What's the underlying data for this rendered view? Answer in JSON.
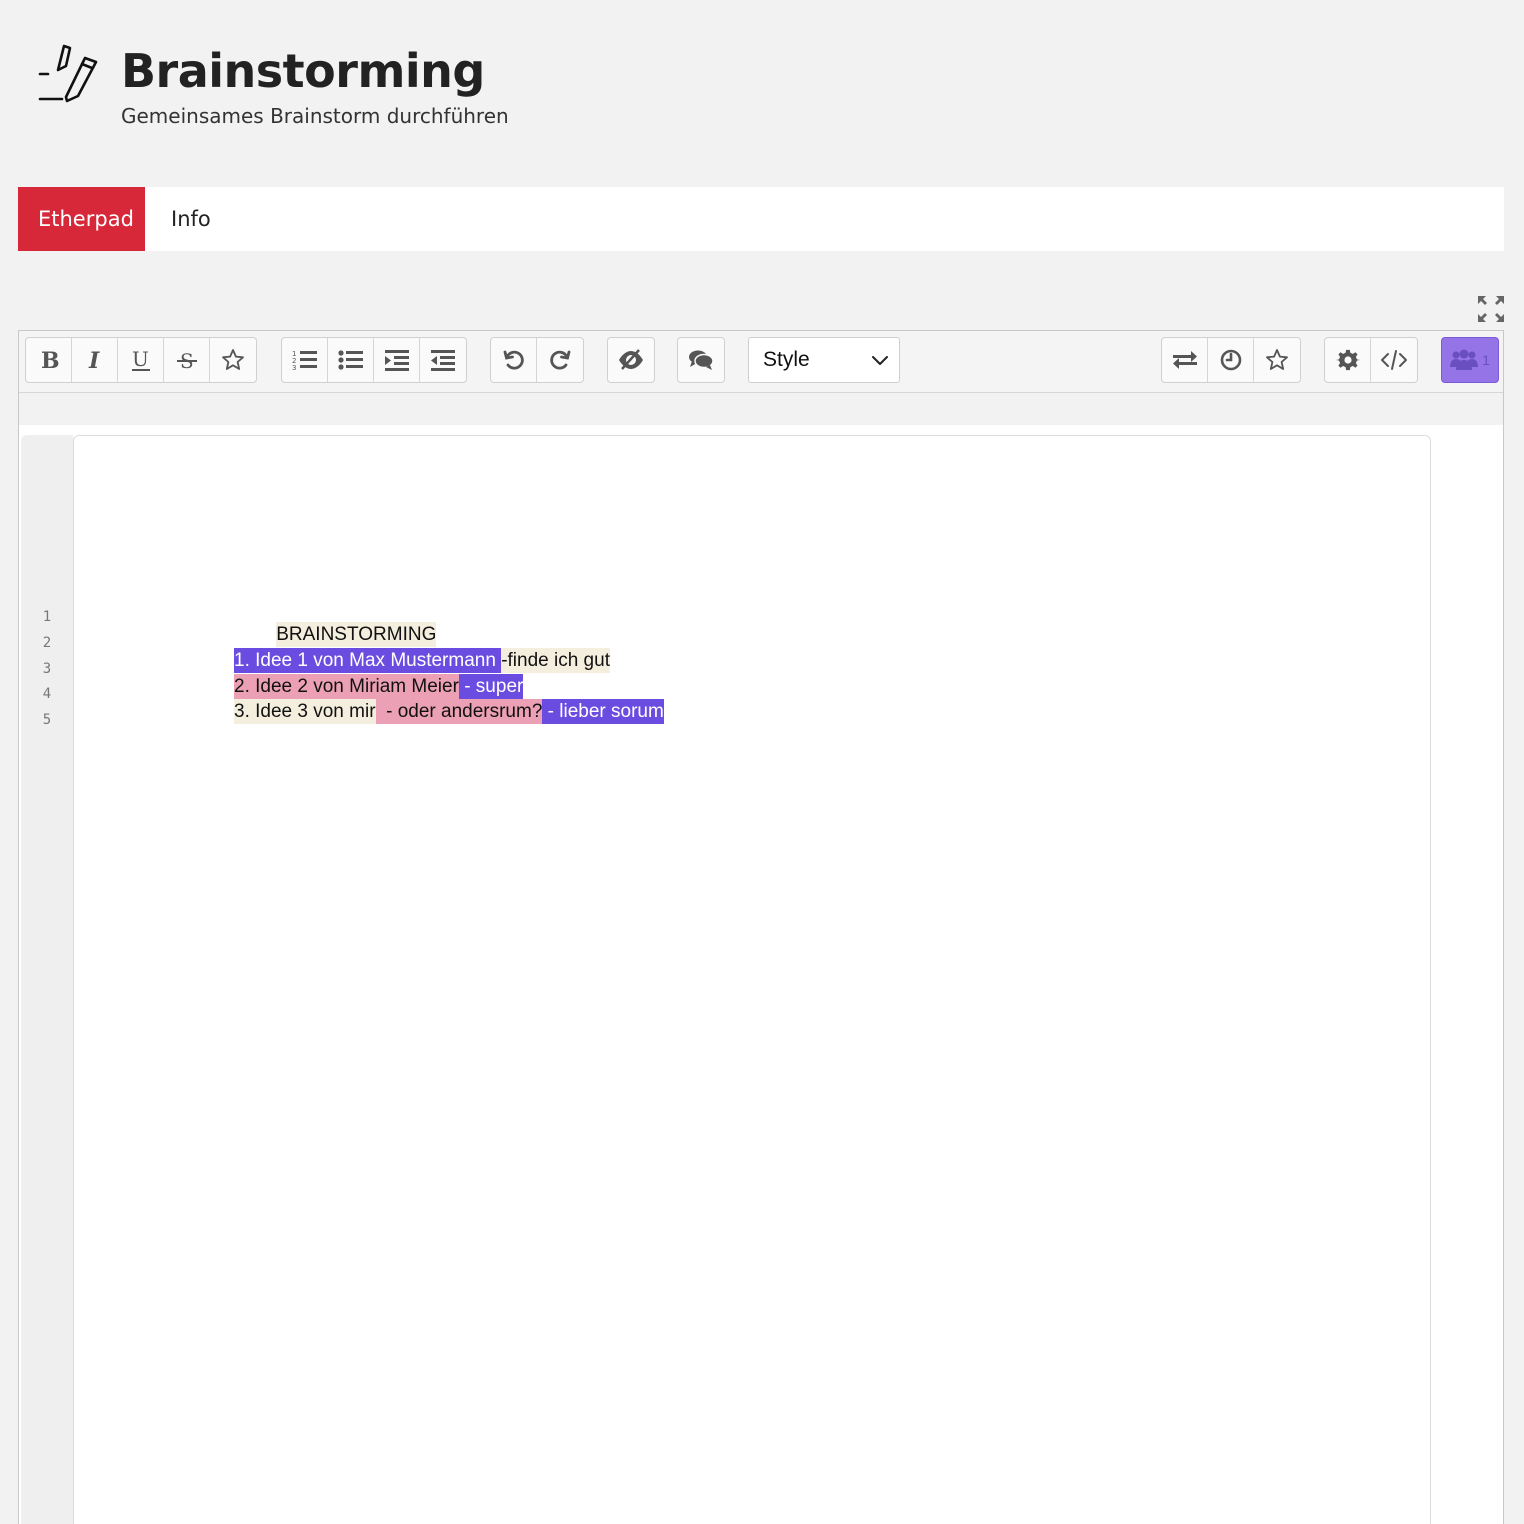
{
  "header": {
    "title": "Brainstorming",
    "subtitle": "Gemeinsames Brainstorm durchführen",
    "icon": "pencil-icon"
  },
  "tabs": [
    {
      "label": "Etherpad",
      "active": true
    },
    {
      "label": "Info",
      "active": false
    }
  ],
  "toolbar": {
    "style_label": "Style",
    "users_count": "1",
    "groups": [
      [
        "bold-icon",
        "italic-icon",
        "underline-icon",
        "strikethrough-icon",
        "star-icon"
      ],
      [
        "ordered-list-icon",
        "unordered-list-icon",
        "indent-icon",
        "outdent-icon"
      ],
      [
        "undo-icon",
        "redo-icon"
      ],
      [
        "eye-slash-icon"
      ],
      [
        "comments-icon"
      ],
      [
        "import-export-icon",
        "history-icon",
        "star-icon"
      ],
      [
        "settings-icon",
        "embed-icon"
      ],
      [
        "users-icon"
      ]
    ]
  },
  "colors": {
    "tab_active": "#d7283a",
    "author_cream": "#f4eede",
    "author_purple": "#6a4de0",
    "author_pink": "#eba0b5"
  },
  "editor": {
    "line_numbers": [
      "1",
      "2",
      "3",
      "4",
      "5"
    ],
    "lines": [
      {
        "segments": [
          {
            "text": "BRAINSTORMING",
            "author": "cream"
          }
        ]
      },
      {
        "segments": []
      },
      {
        "segments": [
          {
            "text": "1. Idee 1 von Max Mustermann ",
            "author": "purple"
          },
          {
            "text": "-finde ich gut",
            "author": "cream"
          }
        ]
      },
      {
        "segments": [
          {
            "text": "2. Idee 2 von Miriam Meier",
            "author": "pink"
          },
          {
            "text": " - super",
            "author": "purple"
          }
        ]
      },
      {
        "segments": [
          {
            "text": "3. Idee 3 von mir",
            "author": "cream"
          },
          {
            "text": "  - oder andersrum?",
            "author": "pink"
          },
          {
            "text": " - lieber sorum",
            "author": "purple"
          }
        ]
      }
    ]
  }
}
